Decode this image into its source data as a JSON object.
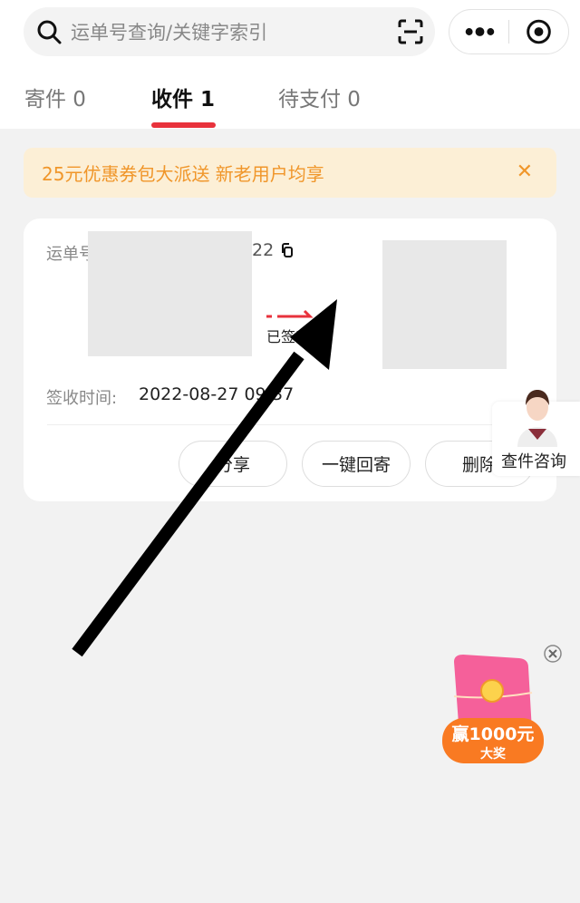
{
  "search": {
    "placeholder": "运单号查询/关键字索引",
    "icon": "search-icon",
    "scan_icon": "scan-icon"
  },
  "capsule": {
    "more_icon": "more-dots-icon",
    "close_icon": "target-circle-icon"
  },
  "tabs": [
    {
      "label": "寄件 0"
    },
    {
      "label": "收件 1",
      "active": true
    },
    {
      "label": "待支付 0"
    }
  ],
  "banner": {
    "text": "25元优惠券包大派送 新老用户均享",
    "close": "✕"
  },
  "card": {
    "waybill_label": "运单号",
    "waybill_tail": "22",
    "status": "已签收",
    "sign_time_label": "签收时间:",
    "sign_time": "2022-08-27 09:37",
    "buttons": [
      "分享",
      "一键回寄",
      "删除"
    ]
  },
  "float_service": {
    "label": "查件咨询"
  },
  "promo": {
    "line1": "赢1000元",
    "line2": "大奖"
  },
  "colors": {
    "accent": "#e8323c",
    "banner_bg": "#fcefd6",
    "banner_text": "#f0962a"
  }
}
